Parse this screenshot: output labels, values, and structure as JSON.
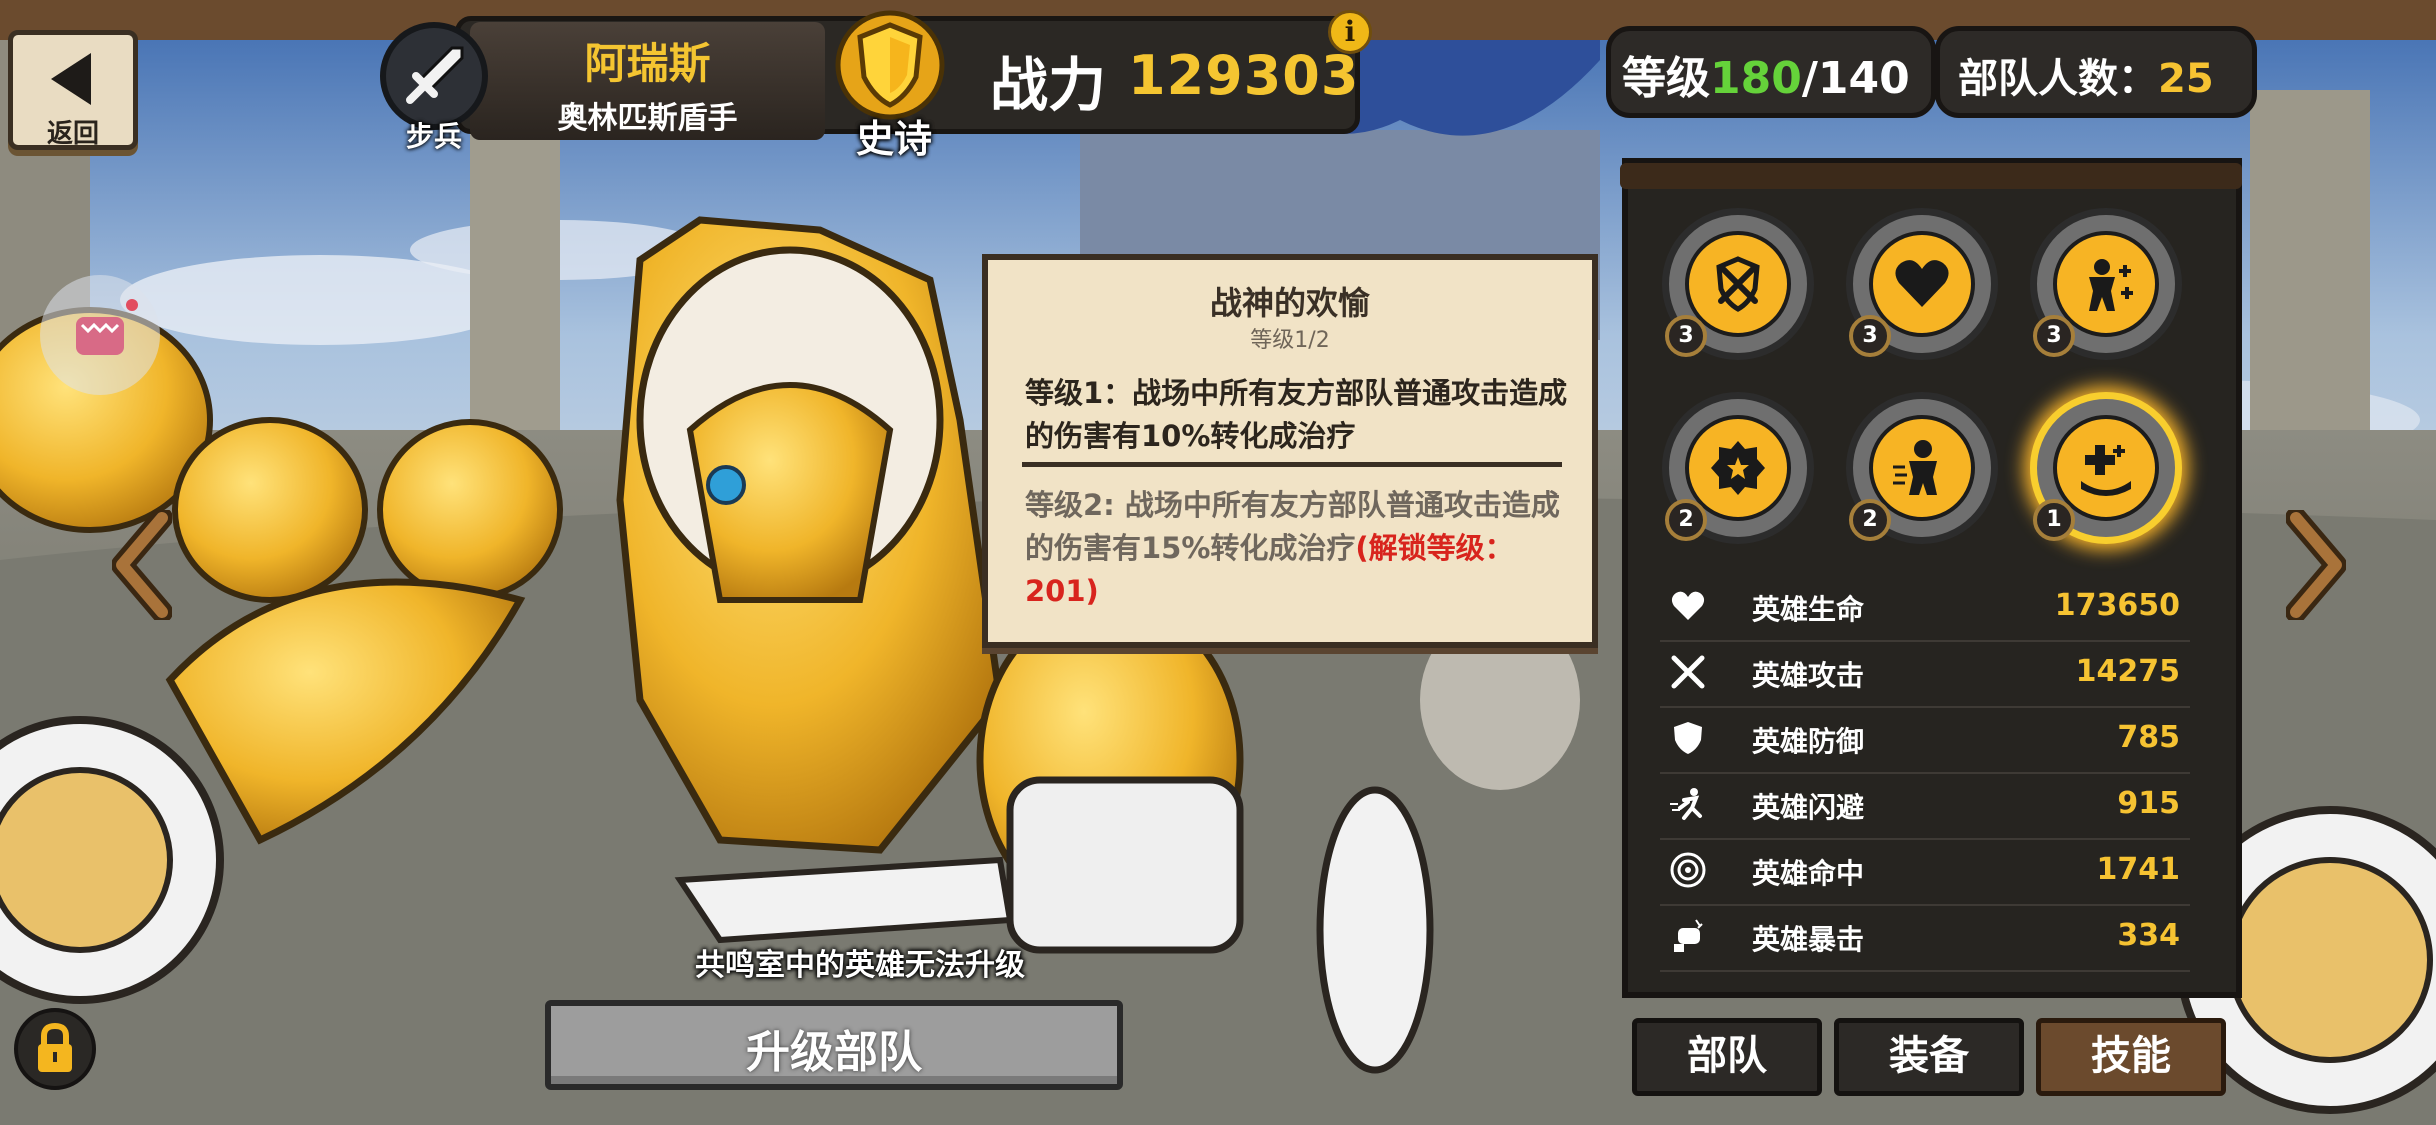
{
  "nav": {
    "back_label": "返回"
  },
  "hero": {
    "name": "阿瑞斯",
    "title": "奥林匹斯盾手",
    "class_label": "步兵",
    "rarity_label": "史诗",
    "power_label": "战力",
    "power_value": "129303",
    "info_icon": "i"
  },
  "level": {
    "label": "等级",
    "current": "180",
    "separator_max": "/140"
  },
  "troops": {
    "label": "部队人数：",
    "count": "25"
  },
  "tooltip": {
    "title": "战神的欢愉",
    "level": "等级1/2",
    "level1_text": "等级1：战场中所有友方部队普通攻击造成的伤害有10%转化成治疗",
    "level2_text": "等级2: 战场中所有友方部队普通攻击造成的伤害有15%转化成治疗",
    "level2_lock": "(解锁等级：201)"
  },
  "skills": [
    {
      "icon": "crossed-swords-shield-icon",
      "level": "3"
    },
    {
      "icon": "heart-icon",
      "level": "3"
    },
    {
      "icon": "person-plus-icon",
      "level": "3"
    },
    {
      "icon": "spiked-shield-icon",
      "level": "2"
    },
    {
      "icon": "speed-person-icon",
      "level": "2"
    },
    {
      "icon": "heal-plus-icon",
      "level": "1"
    }
  ],
  "stats": [
    {
      "icon": "heart-icon",
      "name": "英雄生命",
      "value": "173650"
    },
    {
      "icon": "crossed-swords-icon",
      "name": "英雄攻击",
      "value": "14275"
    },
    {
      "icon": "shield-icon",
      "name": "英雄防御",
      "value": "785"
    },
    {
      "icon": "running-icon",
      "name": "英雄闪避",
      "value": "915"
    },
    {
      "icon": "target-icon",
      "name": "英雄命中",
      "value": "1741"
    },
    {
      "icon": "fist-icon",
      "name": "英雄暴击",
      "value": "334"
    }
  ],
  "tabs": {
    "troops": "部队",
    "equipment": "装备",
    "skills": "技能"
  },
  "bottom": {
    "note": "共鸣室中的英雄无法升级",
    "upgrade_label": "升级部队"
  },
  "colors": {
    "accent_gold": "#f6c332",
    "level_green": "#65d23a",
    "lock_red": "#d8241d"
  }
}
